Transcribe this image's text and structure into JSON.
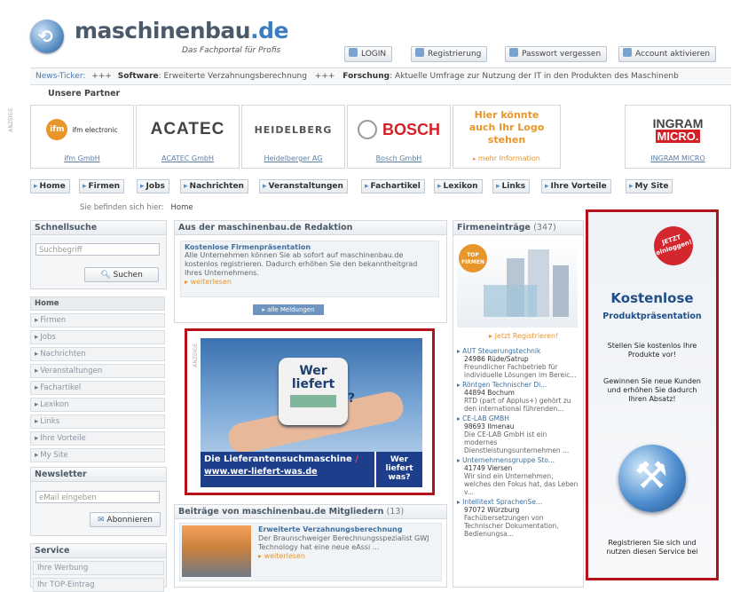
{
  "header": {
    "logo_text_main": "maschinenbau",
    "logo_text_tld": ".de",
    "tagline": "Das Fachportal für Profis",
    "buttons": [
      {
        "label": "LOGIN",
        "icon": "login-icon"
      },
      {
        "label": "Registrierung",
        "icon": "pencil-icon"
      },
      {
        "label": "Passwort vergessen",
        "icon": "key-icon"
      },
      {
        "label": "Account aktivieren",
        "icon": "gear-icon"
      }
    ]
  },
  "ticker": {
    "label": "News-Ticker:",
    "sep1": "+++",
    "item1_title": "Software",
    "item1_text": ": Erweiterte Verzahnungsberechnung",
    "sep2": "+++",
    "item2_title": "Forschung",
    "item2_text": ": Aktuelle Umfrage zur Nutzung der IT in den Produkten des Maschinenb"
  },
  "partners": {
    "title": "Unsere Partner",
    "anzeige": "ANZEIGE",
    "items": [
      {
        "logo": "ifm electronic",
        "link": "ifm GmbH"
      },
      {
        "logo": "ACATEC",
        "link": "ACATEC GmbH"
      },
      {
        "logo": "HEIDELBERG",
        "link": "Heidelberger AG"
      },
      {
        "logo": "BOSCH",
        "link": "Bosch GmbH"
      },
      {
        "logo": "Hier könnte auch Ihr Logo stehen",
        "link": "mehr Information"
      },
      {
        "logo": "INGRAM MICRO",
        "link": "INGRAM MICRO"
      }
    ]
  },
  "nav": [
    "Home",
    "Firmen",
    "Jobs",
    "Nachrichten",
    "Veranstaltungen",
    "Fachartikel",
    "Lexikon",
    "Links",
    "Ihre Vorteile",
    "My Site"
  ],
  "breadcrumb": {
    "label": "Sie befinden sich hier:",
    "current": "Home"
  },
  "sidebar": {
    "search": {
      "title": "Schnellsuche",
      "placeholder": "Suchbegriff",
      "button": "Suchen"
    },
    "menu": [
      "Home",
      "Firmen",
      "Jobs",
      "Nachrichten",
      "Veranstaltungen",
      "Fachartikel",
      "Lexikon",
      "Links",
      "Ihre Vorteile",
      "My Site"
    ],
    "newsletter": {
      "title": "Newsletter",
      "placeholder": "eMail eingeben",
      "button": "Abonnieren"
    },
    "service": {
      "title": "Service",
      "items": [
        "Ihre Werbung",
        "Ihr TOP-Eintrag"
      ]
    }
  },
  "redaktion": {
    "title": "Aus der maschinenbau.de Redaktion",
    "article_title": "Kostenlose Firmenpräsentation",
    "article_text": "Alle Unternehmen können Sie ab sofort auf maschinenbau.de kostenlos registrieren. Dadurch erhöhen Sie den bekanntheitgrad Ihres Unternehmens.",
    "more": "weiterlesen",
    "all_button": "alle Meldungen"
  },
  "mid_ad": {
    "anzeige": "ANZEIGE",
    "card_text": "Wer liefert",
    "card_q": "?",
    "line1_a": "Die ",
    "line1_b": "Lieferantensuchmaschine",
    "line2": "www.wer-liefert-was.de",
    "logo": "Wer liefert was?"
  },
  "mitglieder": {
    "title": "Beiträge von maschinenbau.de Mitgliedern",
    "count": "(13)",
    "article_title": "Erweiterte Verzahnungsberechnung",
    "article_text": "Der Braunschweiger Berechnungsspezialist GWJ Technology hat eine neue eAssi ...",
    "more": "weiterlesen"
  },
  "firmen": {
    "title": "Firmeneinträge",
    "count": "(347)",
    "top_badge": "TOP FIRMEN",
    "register": "Jetzt Registrieren!",
    "entries": [
      {
        "name": "AUT Steuerungstechnik",
        "city": "24986 Rüde/Satrup",
        "desc": "Freundlicher Fachbetrieb für individuelle Lösungen im Bereic..."
      },
      {
        "name": "Röntgen Technischer Di...",
        "city": "44894 Bochum",
        "desc": "RTD (part of Applus+) gehört zu den international führenden..."
      },
      {
        "name": "CE-LAB GMBH",
        "city": "98693 Ilmenau",
        "desc": "Die CE-LAB GmbH ist ein modernes Dienstleistungsunternehmen ..."
      },
      {
        "name": "Unternehmensgruppe Sto...",
        "city": "41749 Viersen",
        "desc": "Wir sind ein Unternehmen, welches den Fokus hat, das Leben v..."
      },
      {
        "name": "Intellitext SprachenSe...",
        "city": "97072 Würzburg",
        "desc": "Fachübersetzungen von Technischer Dokumentation, Bedienungsa..."
      }
    ]
  },
  "right_ad": {
    "badge": "JETZT einloggen!",
    "title1": "Kostenlose",
    "title2": "Produktpräsentation",
    "text1": "Stellen Sie kostenlos Ihre Produkte vor!",
    "text2": "Gewinnen Sie neue Kunden und erhöhen Sie dadurch Ihren Absatz!",
    "text3": "Registrieren Sie sich und nutzen diesen Service bei"
  },
  "colors": {
    "accent": "#3e7cc0",
    "ad_border": "#b5121b",
    "link": "#5a7fa8",
    "orange": "#e8952a"
  }
}
